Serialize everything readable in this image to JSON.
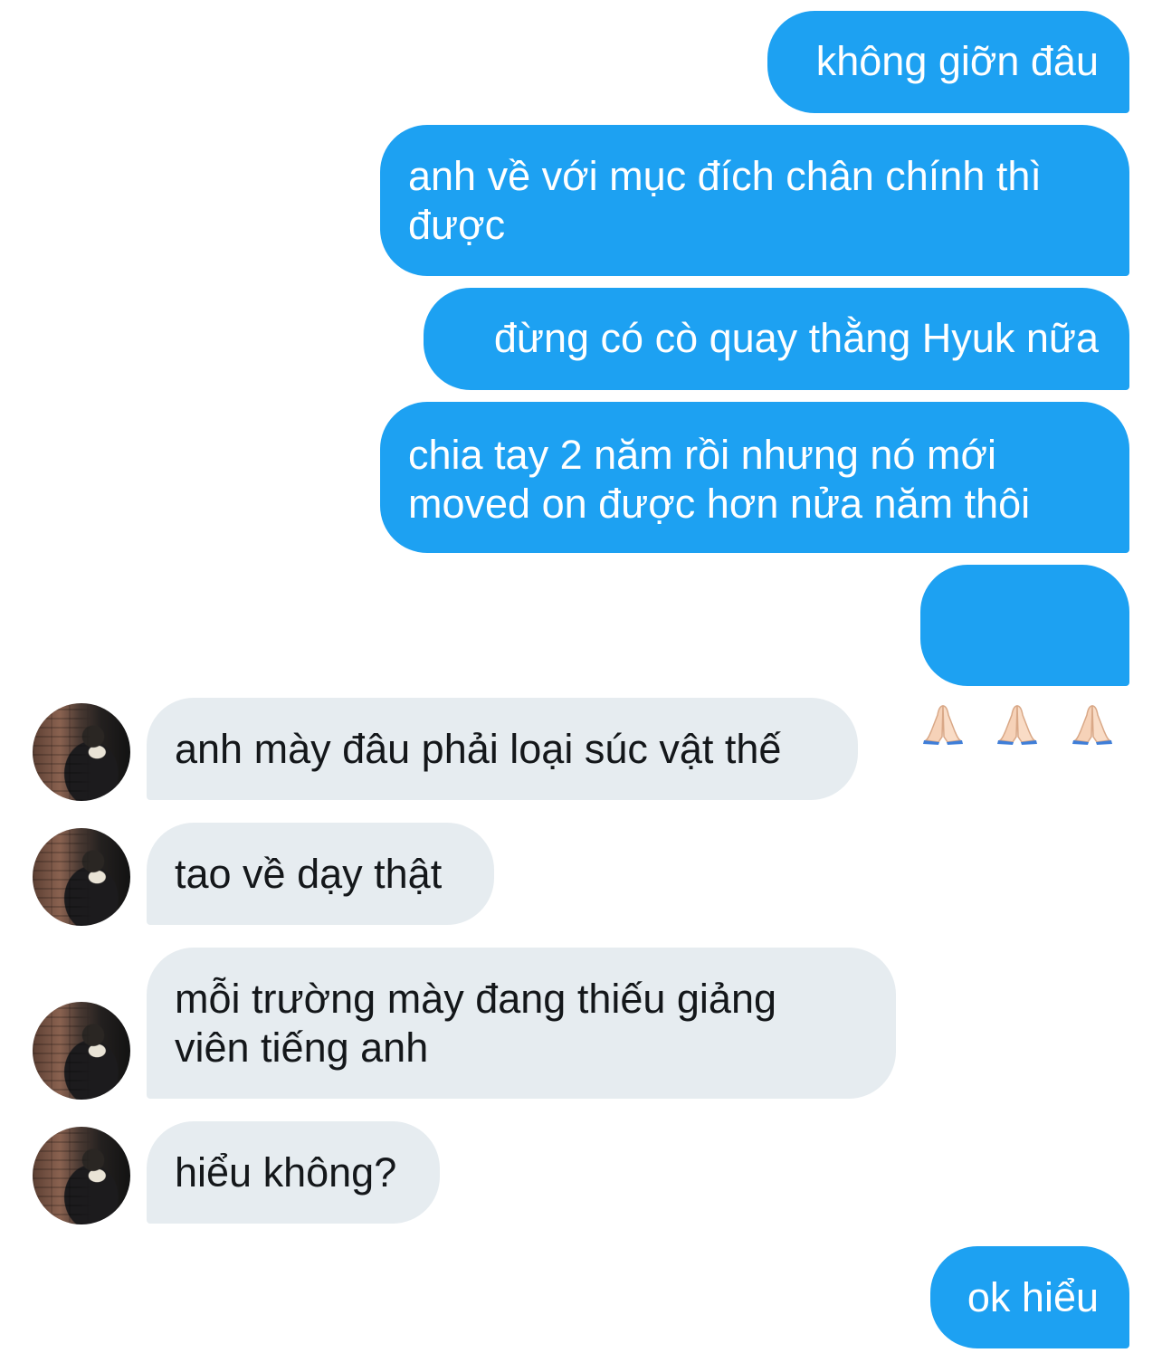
{
  "messages": [
    {
      "side": "outgoing",
      "text": "không giỡn đâu"
    },
    {
      "side": "outgoing",
      "text": "anh về với mục đích chân chính thì\nđược"
    },
    {
      "side": "outgoing",
      "text": "đừng có cò quay thằng Hyuk nữa"
    },
    {
      "side": "outgoing",
      "text": "chia tay 2 năm rồi nhưng nó mới\nmoved on được hơn nửa năm thôi"
    },
    {
      "side": "outgoing",
      "emoji": [
        "folded-hands-icon",
        "folded-hands-icon",
        "folded-hands-icon"
      ]
    },
    {
      "side": "incoming",
      "text": "anh mày đâu phải loại súc vật thế"
    },
    {
      "side": "incoming",
      "text": "tao về dạy thật"
    },
    {
      "side": "incoming",
      "text": "mỗi trường mày đang thiếu giảng\nviên tiếng anh"
    },
    {
      "side": "incoming",
      "text": "hiểu không?"
    },
    {
      "side": "outgoing",
      "text": "ok hiểu"
    }
  ],
  "colors": {
    "outgoing_bubble": "#1da1f2",
    "incoming_bubble": "#e6ecf0",
    "outgoing_text": "#ffffff",
    "incoming_text": "#14171a"
  }
}
